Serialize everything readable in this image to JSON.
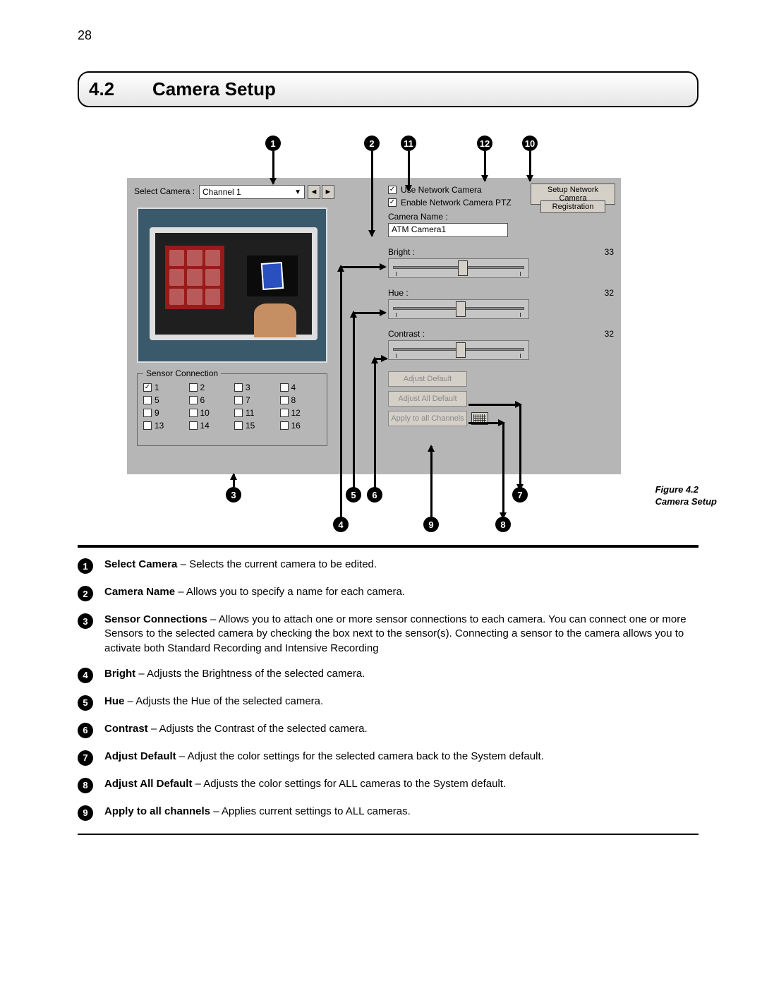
{
  "page_number": "28",
  "section": {
    "number": "4.2",
    "title": "Camera Setup"
  },
  "figure_caption": {
    "l1": "Figure 4.2",
    "l2": "Camera Setup"
  },
  "panel": {
    "select_camera_label": "Select Camera :",
    "select_camera_value": "Channel 1",
    "use_network_camera": "Use Network Camera",
    "enable_ptz": "Enable Network Camera PTZ",
    "setup_network_camera": "Setup Network Camera",
    "registration": "Registration",
    "camera_name_label": "Camera Name :",
    "camera_name_value": "ATM Camera1",
    "sensor_legend": "Sensor Connection",
    "sliders": {
      "bright": {
        "label": "Bright :",
        "value": "33"
      },
      "hue": {
        "label": "Hue :",
        "value": "32"
      },
      "contrast": {
        "label": "Contrast :",
        "value": "32"
      }
    },
    "buttons": {
      "adjust_default": "Adjust Default",
      "adjust_all_default": "Adjust All Default",
      "apply_all": "Apply to all Channels"
    },
    "sensors": [
      "1",
      "2",
      "3",
      "4",
      "5",
      "6",
      "7",
      "8",
      "9",
      "10",
      "11",
      "12",
      "13",
      "14",
      "15",
      "16"
    ]
  },
  "markers": {
    "m1": "1",
    "m2": "2",
    "m3": "3",
    "m4": "4",
    "m5": "5",
    "m6": "6",
    "m7": "7",
    "m8": "8",
    "m9": "9",
    "m10": "10",
    "m11": "11",
    "m12": "12"
  },
  "descriptions": [
    {
      "n": "1",
      "term": "Select Camera",
      "text": " – Selects the current camera to be edited."
    },
    {
      "n": "2",
      "term": "Camera Name",
      "text": " – Allows you to specify a name for each camera."
    },
    {
      "n": "3",
      "term": "Sensor Connections",
      "text": " – Allows you to attach one or more sensor connections to each camera. You can connect one or more Sensors to the selected camera by checking the box next to the sensor(s). Connecting a sensor to the camera allows you to activate both Standard Recording and Intensive Recording"
    },
    {
      "n": "4",
      "term": "Bright",
      "text": " – Adjusts the Brightness of the selected camera."
    },
    {
      "n": "5",
      "term": "Hue",
      "text": " – Adjusts the Hue of the selected camera."
    },
    {
      "n": "6",
      "term": "Contrast",
      "text": " – Adjusts the Contrast of the selected camera."
    },
    {
      "n": "7",
      "term": "Adjust Default",
      "text": " – Adjust the color settings for the selected camera back to the System default."
    },
    {
      "n": "8",
      "term": "Adjust All Default",
      "text": " – Adjusts the color settings for ALL cameras to the System default."
    },
    {
      "n": "9",
      "term": "Apply to all channels",
      "text": " – Applies current settings to ALL cameras."
    }
  ]
}
